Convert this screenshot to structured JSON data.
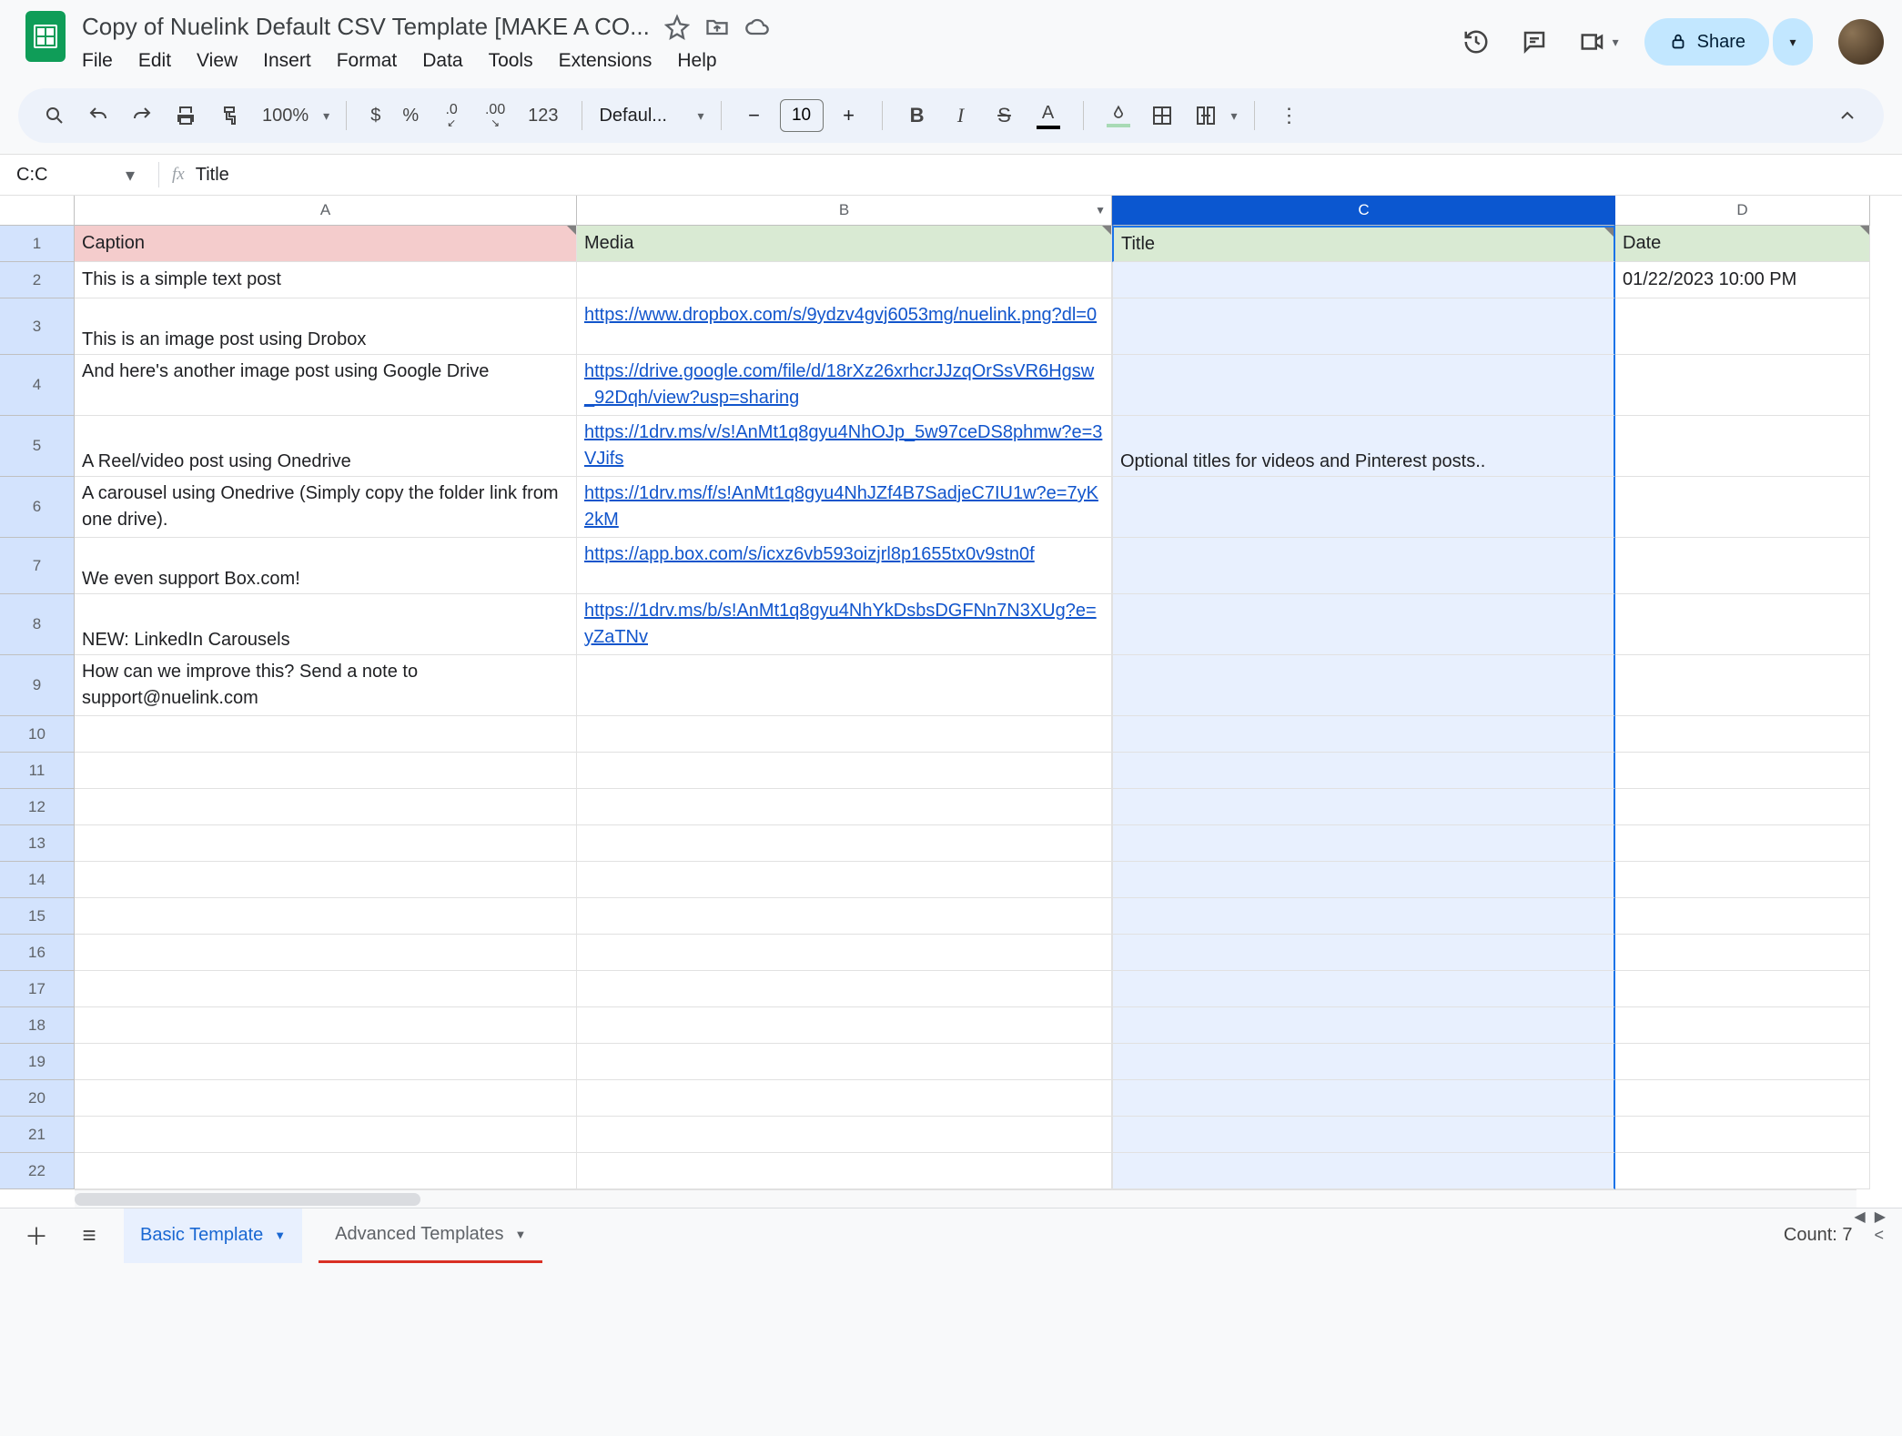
{
  "doc": {
    "title": "Copy of Nuelink Default CSV Template [MAKE A CO..."
  },
  "menu": {
    "file": "File",
    "edit": "Edit",
    "view": "View",
    "insert": "Insert",
    "format": "Format",
    "data": "Data",
    "tools": "Tools",
    "extensions": "Extensions",
    "help": "Help"
  },
  "share": {
    "label": "Share"
  },
  "toolbar": {
    "zoom": "100%",
    "currency": "$",
    "percent": "%",
    "decDec": ".0",
    "incDec": ".00",
    "num123": "123",
    "font": "Defaul...",
    "fontSize": "10"
  },
  "namebox": {
    "ref": "C:C",
    "formula": "Title"
  },
  "columns": {
    "a": "A",
    "b": "B",
    "c": "C",
    "d": "D"
  },
  "headers": {
    "caption": "Caption",
    "media": "Media",
    "title": "Title",
    "date": "Date"
  },
  "rows": [
    {
      "n": "1"
    },
    {
      "n": "2",
      "caption": "This is a simple text post",
      "media": "",
      "title": "",
      "date": "01/22/2023 10:00 PM"
    },
    {
      "n": "3",
      "caption": "This is an image post using Drobox",
      "media": "https://www.dropbox.com/s/9ydzv4gvj6053mg/nuelink.png?dl=0",
      "title": "",
      "date": ""
    },
    {
      "n": "4",
      "caption": "And here's another image post using Google Drive",
      "media": "https://drive.google.com/file/d/18rXz26xrhcrJJzqOrSsVR6Hgsw_92Dqh/view?usp=sharing",
      "title": "",
      "date": ""
    },
    {
      "n": "5",
      "caption": "A Reel/video post using Onedrive",
      "media": "https://1drv.ms/v/s!AnMt1q8gyu4NhOJp_5w97ceDS8phmw?e=3VJifs",
      "title": "Optional titles for videos and Pinterest posts..",
      "date": ""
    },
    {
      "n": "6",
      "caption": "A carousel using Onedrive (Simply copy the folder link from one drive).",
      "media": "https://1drv.ms/f/s!AnMt1q8gyu4NhJZf4B7SadjeC7IU1w?e=7yK2kM",
      "title": "",
      "date": ""
    },
    {
      "n": "7",
      "caption": "We even support Box.com!",
      "media": "https://app.box.com/s/icxz6vb593oizjrl8p1655tx0v9stn0f",
      "title": "",
      "date": ""
    },
    {
      "n": "8",
      "caption": "NEW: LinkedIn Carousels",
      "media": "https://1drv.ms/b/s!AnMt1q8gyu4NhYkDsbsDGFNn7N3XUg?e=yZaTNv",
      "title": "",
      "date": ""
    },
    {
      "n": "9",
      "caption": "How can we improve this? Send a note to support@nuelink.com",
      "media": "",
      "title": "",
      "date": ""
    },
    {
      "n": "10"
    },
    {
      "n": "11"
    },
    {
      "n": "12"
    },
    {
      "n": "13"
    },
    {
      "n": "14"
    },
    {
      "n": "15"
    },
    {
      "n": "16"
    },
    {
      "n": "17"
    },
    {
      "n": "18"
    },
    {
      "n": "19"
    },
    {
      "n": "20"
    },
    {
      "n": "21"
    },
    {
      "n": "22"
    }
  ],
  "tabs": {
    "basic": "Basic Template",
    "advanced": "Advanced Templates"
  },
  "status": {
    "count": "Count: 7"
  }
}
